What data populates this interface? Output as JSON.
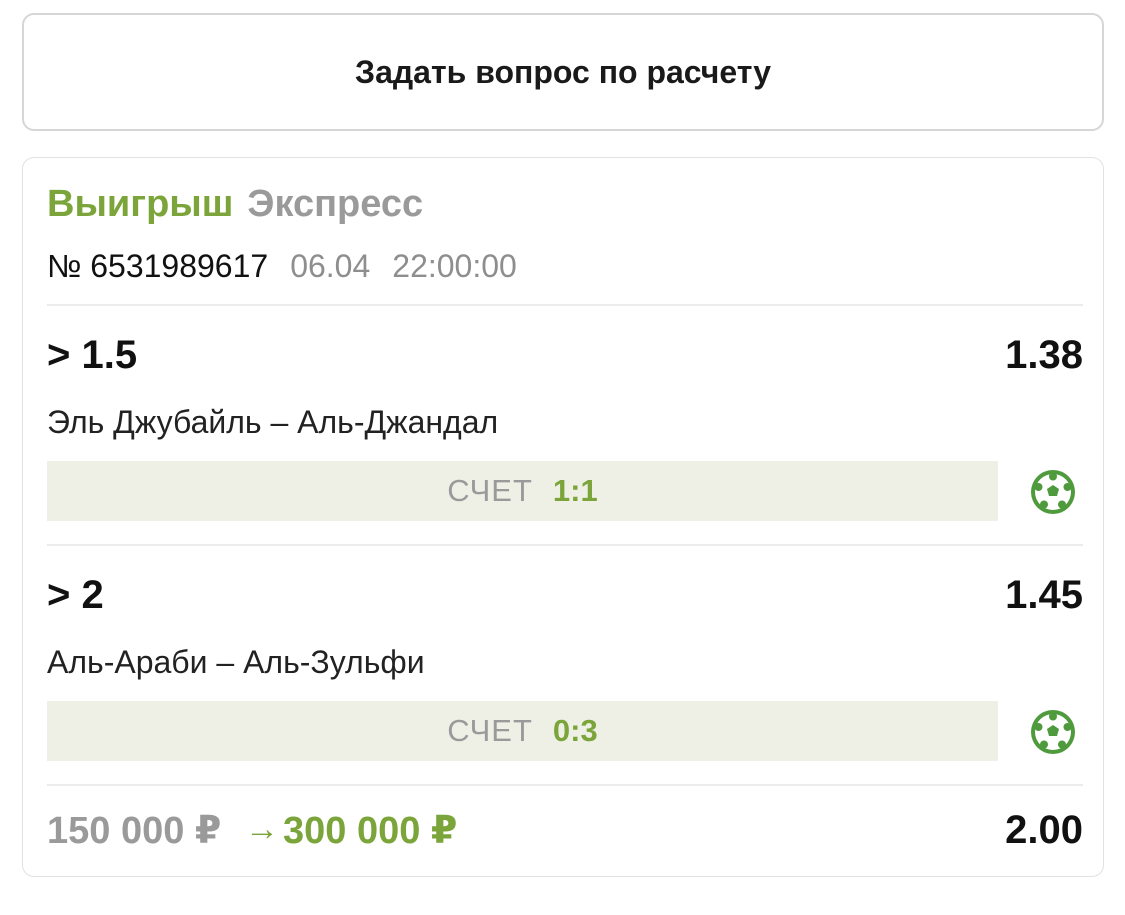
{
  "ask_button": {
    "label": "Задать вопрос по расчету"
  },
  "bet": {
    "status": "Выигрыш",
    "type": "Экспресс",
    "number": "№ 6531989617",
    "date": "06.04",
    "time": "22:00:00",
    "legs": [
      {
        "outcome": "> 1.5",
        "odds": "1.38",
        "match": "Эль Джубайль – Аль-Джандал",
        "score_label": "СЧЕТ",
        "score": "1:1",
        "sport_icon": "soccer-ball-icon"
      },
      {
        "outcome": "> 2",
        "odds": "1.45",
        "match": "Аль-Араби – Аль-Зульфи",
        "score_label": "СЧЕТ",
        "score": "0:3",
        "sport_icon": "soccer-ball-icon"
      }
    ],
    "stake": "150 000 ₽",
    "arrow": "→",
    "payout": "300 000 ₽",
    "total_odds": "2.00"
  },
  "colors": {
    "accent_green": "#7ba53a",
    "muted_gray": "#9a9a9a",
    "score_bg": "#eef0e6",
    "icon_green": "#4f9a3c"
  }
}
